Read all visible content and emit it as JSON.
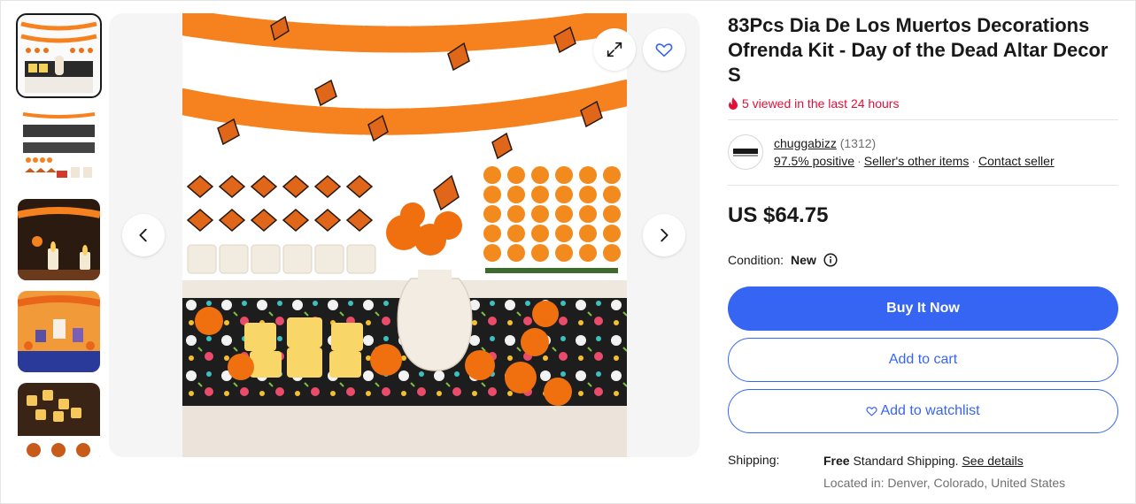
{
  "listing": {
    "title": "83Pcs Dia De Los Muertos Decorations Ofrenda Kit - Day of the Dead Altar Decor S",
    "viewed": "5 viewed in the last 24 hours"
  },
  "seller": {
    "name": "chuggabizz",
    "feedback_count": "(1312)",
    "positive": "97.5% positive",
    "other_items": "Seller's other items",
    "contact": "Contact seller"
  },
  "price": "US $64.75",
  "condition": {
    "label": "Condition:",
    "value": "New"
  },
  "buttons": {
    "buy_now": "Buy It Now",
    "add_to_cart": "Add to cart",
    "add_to_watchlist": "Add to watchlist"
  },
  "shipping": {
    "label": "Shipping:",
    "free": "Free",
    "method": " Standard Shipping. ",
    "details_link": "See details",
    "located": "Located in: Denver, Colorado, United States"
  },
  "gallery": {
    "thumbnail_count": 5,
    "selected_index": 0,
    "icons": [
      "expand-icon",
      "heart-icon",
      "chevron-left-icon",
      "chevron-right-icon",
      "flame-icon",
      "info-icon"
    ]
  },
  "colors": {
    "accent": "#3665f3",
    "alert": "#e0103a",
    "marigold": "#f5821f",
    "text": "#191919",
    "muted": "#707070"
  }
}
